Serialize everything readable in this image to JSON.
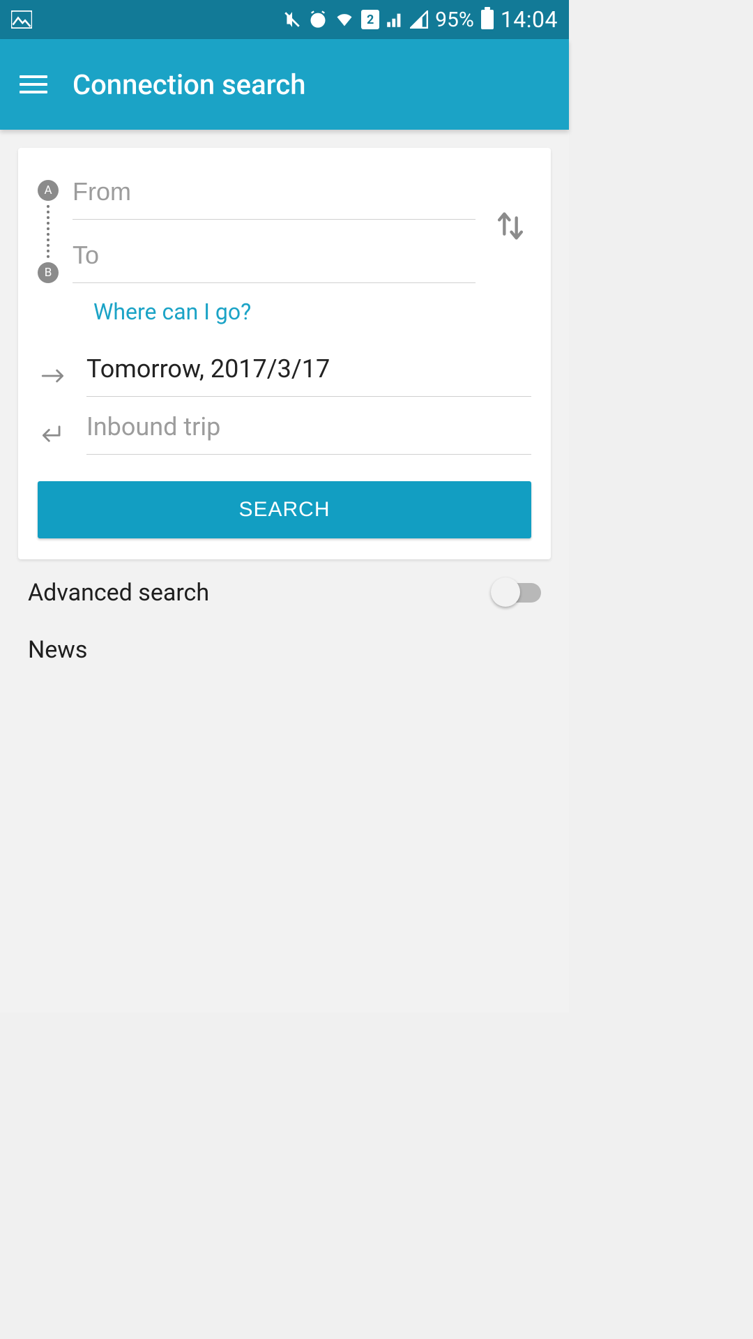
{
  "status_bar": {
    "sim_badge": "2",
    "battery_percent": "95%",
    "time": "14:04"
  },
  "app_bar": {
    "title": "Connection search"
  },
  "search_card": {
    "marker_a": "A",
    "marker_b": "B",
    "from_placeholder": "From",
    "from_value": "",
    "to_placeholder": "To",
    "to_value": "",
    "where_link": "Where can I go?",
    "outbound_value": "Tomorrow, 2017/3/17",
    "inbound_placeholder": "Inbound trip",
    "inbound_value": "",
    "search_button": "SEARCH"
  },
  "advanced": {
    "label": "Advanced search",
    "enabled": false
  },
  "news": {
    "label": "News"
  }
}
